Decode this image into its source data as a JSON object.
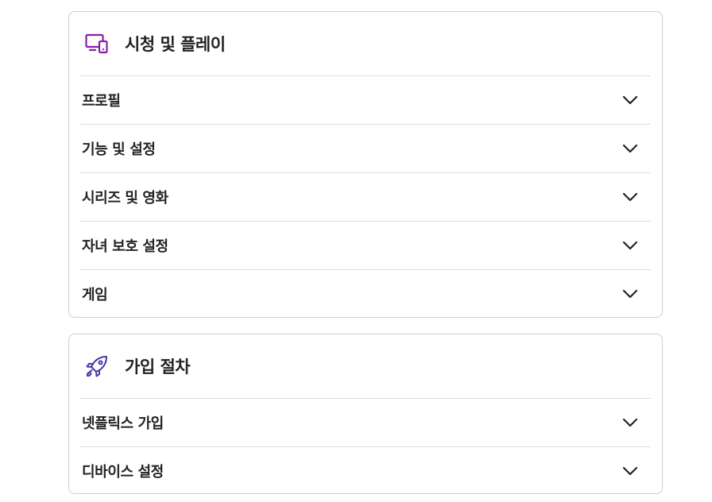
{
  "colors": {
    "accent_watch": "#8a1fa6",
    "accent_signup": "#4c3aa8",
    "text": "#232323",
    "border": "#cfcfcf",
    "divider": "#dddddd"
  },
  "sections": [
    {
      "title": "시청 및 플레이",
      "icon": "devices-icon",
      "items": [
        {
          "label": "프로필",
          "icon": "chevron-down-icon"
        },
        {
          "label": "기능 및 설정",
          "icon": "chevron-down-icon"
        },
        {
          "label": "시리즈 및 영화",
          "icon": "chevron-down-icon"
        },
        {
          "label": "자녀 보호 설정",
          "icon": "chevron-down-icon"
        },
        {
          "label": "게임",
          "icon": "chevron-down-icon"
        }
      ]
    },
    {
      "title": "가입 절차",
      "icon": "rocket-icon",
      "items": [
        {
          "label": "넷플릭스 가입",
          "icon": "chevron-down-icon"
        },
        {
          "label": "디바이스 설정",
          "icon": "chevron-down-icon"
        }
      ]
    }
  ]
}
